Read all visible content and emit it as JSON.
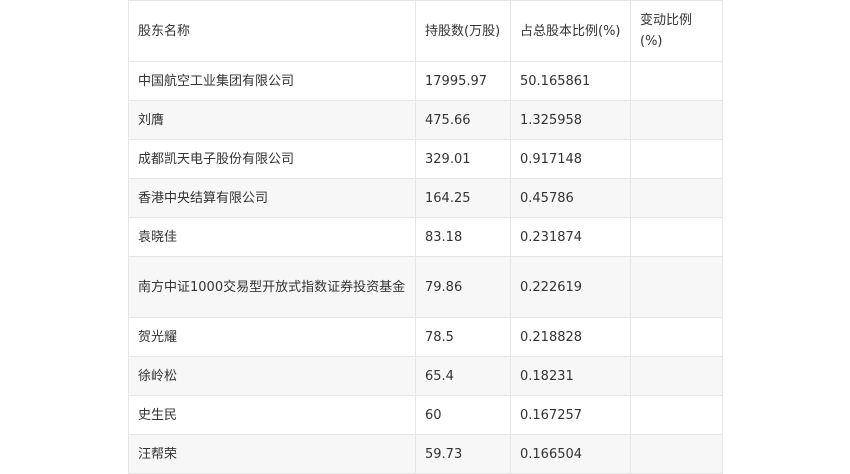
{
  "table": {
    "headers": [
      "股东名称",
      "持股数(万股)",
      "占总股本比例(%)",
      "变动比例(%)"
    ],
    "rows": [
      [
        "中国航空工业集团有限公司",
        "17995.97",
        "50.165861",
        ""
      ],
      [
        "刘膺",
        "475.66",
        "1.325958",
        ""
      ],
      [
        "成都凯天电子股份有限公司",
        "329.01",
        "0.917148",
        ""
      ],
      [
        "香港中央结算有限公司",
        "164.25",
        "0.45786",
        ""
      ],
      [
        "袁晓佳",
        "83.18",
        "0.231874",
        ""
      ],
      [
        "南方中证1000交易型开放式指数证券投资基金",
        "79.86",
        "0.222619",
        ""
      ],
      [
        "贺光耀",
        "78.5",
        "0.218828",
        ""
      ],
      [
        "徐岭松",
        "65.4",
        "0.18231",
        ""
      ],
      [
        "史生民",
        "60",
        "0.167257",
        ""
      ],
      [
        "汪帮荣",
        "59.73",
        "0.166504",
        ""
      ]
    ]
  }
}
